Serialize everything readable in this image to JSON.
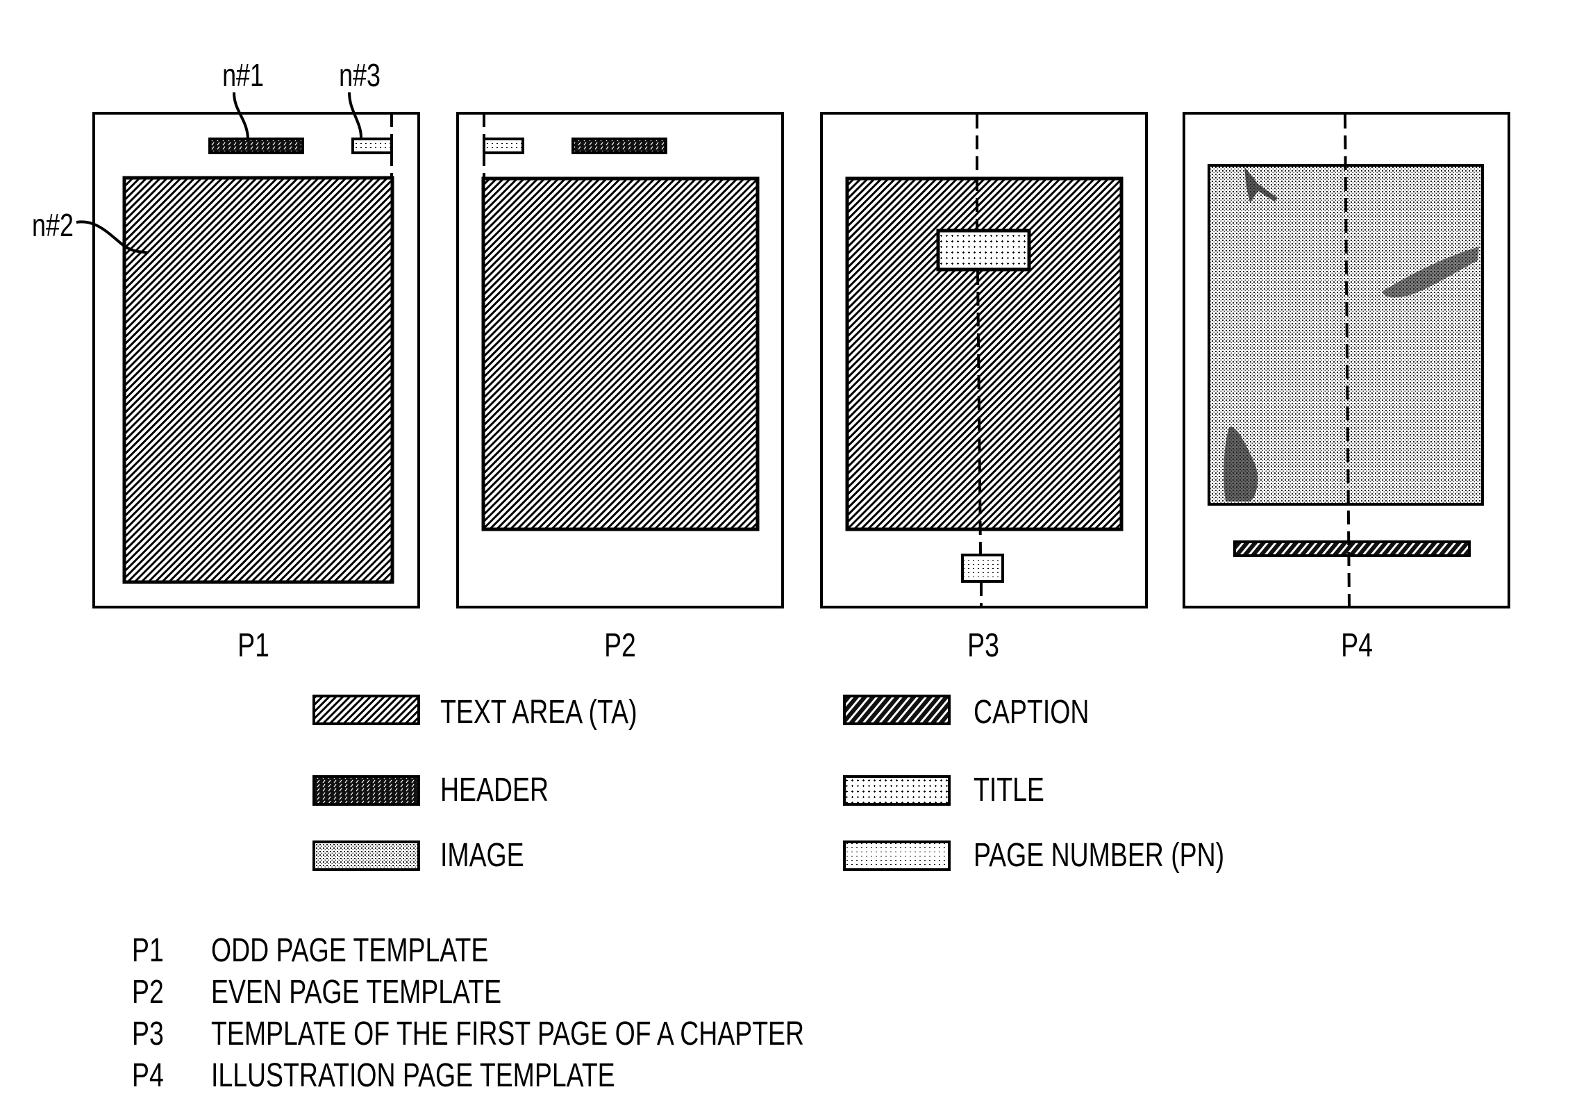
{
  "callouts": {
    "n1": "n#1",
    "n2": "n#2",
    "n3": "n#3"
  },
  "pages": [
    {
      "id": "P1",
      "label": "P1"
    },
    {
      "id": "P2",
      "label": "P2"
    },
    {
      "id": "P3",
      "label": "P3"
    },
    {
      "id": "P4",
      "label": "P4"
    }
  ],
  "legend": [
    {
      "key": "text_area",
      "label": "TEXT AREA (TA)",
      "pattern": "text-area"
    },
    {
      "key": "header",
      "label": "HEADER",
      "pattern": "header"
    },
    {
      "key": "image",
      "label": "IMAGE",
      "pattern": "image"
    },
    {
      "key": "caption",
      "label": "CAPTION",
      "pattern": "caption"
    },
    {
      "key": "title",
      "label": "TITLE",
      "pattern": "title"
    },
    {
      "key": "page_number",
      "label": "PAGE NUMBER (PN)",
      "pattern": "page-number"
    }
  ],
  "descriptions": [
    {
      "code": "P1",
      "text": "ODD PAGE TEMPLATE"
    },
    {
      "code": "P2",
      "text": "EVEN PAGE TEMPLATE"
    },
    {
      "code": "P3",
      "text": "TEMPLATE OF THE FIRST PAGE OF A CHAPTER"
    },
    {
      "code": "P4",
      "text": "ILLUSTRATION PAGE TEMPLATE"
    }
  ]
}
